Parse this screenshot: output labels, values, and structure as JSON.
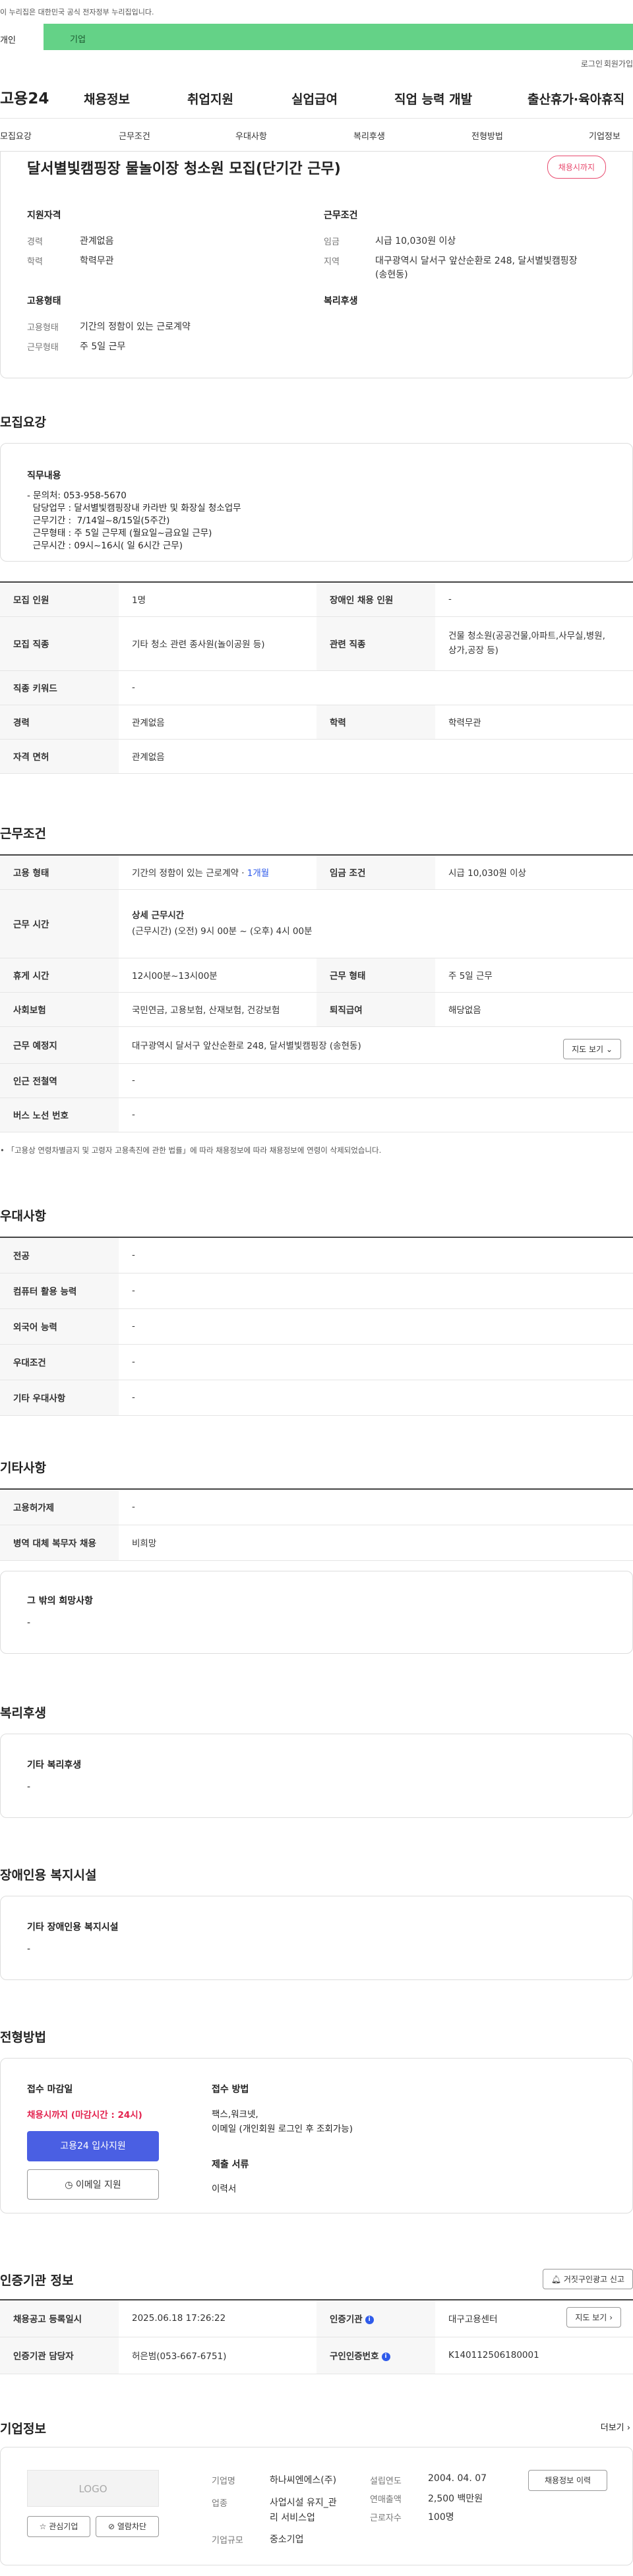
{
  "header": {
    "gov_notice": "이 누리집은 대한민국 공식 전자정부 누리집입니다.",
    "tab_individual": "개인",
    "tab_corporate": "기업",
    "login": "로그인",
    "join": "회원가입"
  },
  "gnb": {
    "logo": "고용24",
    "menus": [
      "채용정보",
      "취업지원",
      "실업급여",
      "직업 능력 개발",
      "출산휴가·육아휴직"
    ]
  },
  "subnav": [
    "모집요강",
    "근무조건",
    "우대사항",
    "복리후생",
    "전형방법",
    "기업정보"
  ],
  "summary": {
    "title": "달서별빛캠핑장 물놀이장 청소원 모집(단기간 근무)",
    "status": "채용시까지",
    "qualification_heading": "지원자격",
    "career_label": "경력",
    "career_value": "관계없음",
    "education_label": "학력",
    "education_value": "학력무관",
    "work_heading": "근무조건",
    "wage_label": "임금",
    "wage_value": "시급 10,030원 이상",
    "location_label": "지역",
    "location_value_1": "대구광역시 달서구 앞산순환로 248, 달서별빛캠핑장",
    "location_value_2": "(송현동)",
    "employment_heading": "고용형태",
    "emp_type_label": "고용형태",
    "emp_type_value": "기간의 정함이 있는 근로계약",
    "work_form_label": "근무형태",
    "work_form_value": "주 5일 근무",
    "welfare_heading": "복리후생"
  },
  "recruit": {
    "heading": "모집요강",
    "duty_heading": "직무내용",
    "duty_lines": [
      "- 문의처: 053-958-5670",
      "  담당업무 : 달서별빛캠핑장내 카라반 및 화장실 청소업무",
      "  근무기간 :  7/14일~8/15일(5주간)",
      "  근무형태 : 주 5일 근무제 (월요일~금요일 근무)",
      "  근무시간 : 09시~16시( 일 6시간 근무)"
    ],
    "rows": [
      {
        "k1": "모집 인원",
        "v1": "1명",
        "k2": "장애인 채용 인원",
        "v2": "-"
      },
      {
        "k1": "모집 직종",
        "v1": "기타 청소 관련 종사원(놀이공원 등)",
        "k2": "관련 직종",
        "v2a": "건물 청소원(공공건물,아파트,사무실,병원,",
        "v2b": "상가,공장 등)"
      },
      {
        "k1": "직종 키워드",
        "v1": "-"
      },
      {
        "k1": "경력",
        "v1": "관계없음",
        "k2": "학력",
        "v2": "학력무관"
      },
      {
        "k1": "자격 면허",
        "v1": "관계없음"
      }
    ]
  },
  "conditions": {
    "heading": "근무조건",
    "emp_type_k": "고용 형태",
    "emp_type_v": "기간의 정함이 있는 근로계약 · ",
    "emp_type_v_blue": "1개월",
    "wage_k": "임금 조건",
    "wage_v": "시급 10,030원 이상",
    "hours_k": "근무 시간",
    "hours_title": "상세 근무시간",
    "hours_v": "(근무시간) (오전) 9시 00분 ~ (오후) 4시 00분",
    "break_k": "휴게 시간",
    "break_v": "12시00분~13시00분",
    "form_k": "근무 형태",
    "form_v": "주 5일 근무",
    "insurance_k": "사회보험",
    "insurance_v": "국민연금, 고용보험, 산재보험, 건강보험",
    "severance_k": "퇴직급여",
    "severance_v": "해당없음",
    "place_k": "근무 예정지",
    "place_v": "대구광역시 달서구 앞산순환로 248, 달서별빛캠핑장 (송현동)",
    "map_button": "지도 보기",
    "subway_k": "인근 전철역",
    "subway_v": "-",
    "bus_k": "버스 노선 번호",
    "bus_v": "-",
    "note": "「고용상 연령차별금지 및 고령자 고용촉진에 관한 법률」에 따라 채용정보에 따라 채용정보에 연령이 삭제되었습니다."
  },
  "preferences": {
    "heading": "우대사항",
    "rows": [
      {
        "k": "전공",
        "v": "-"
      },
      {
        "k": "컴퓨터 활용 능력",
        "v": "-"
      },
      {
        "k": "외국어 능력",
        "v": "-"
      },
      {
        "k": "우대조건",
        "v": "-"
      },
      {
        "k": "기타 우대사항",
        "v": "-"
      }
    ]
  },
  "etc": {
    "heading": "기타사항",
    "rows": [
      {
        "k": "고용허가제",
        "v": "-"
      },
      {
        "k": "병역 대체 복무자 채용",
        "v": "비희망"
      }
    ],
    "other_heading": "그 밖의 희망사항",
    "other_value": "-"
  },
  "welfare": {
    "heading": "복리후생",
    "sub_heading": "기타 복리후생",
    "value": "-"
  },
  "disability": {
    "heading": "장애인용 복지시설",
    "sub_heading": "기타 장애인용 복지시설",
    "value": "-"
  },
  "selection": {
    "heading": "전형방법",
    "deadline_heading": "접수 마감일",
    "deadline_value": "채용시까지 (마감시간 : 24시)",
    "apply_button": "고용24 입사지원",
    "email_button": "이메일 지원",
    "method_heading": "접수 방법",
    "method_line1": "팩스,워크넷,",
    "method_line2": "이메일 (개인회원 로그인 후 조회가능)",
    "docs_heading": "제출 서류",
    "docs_value": "이력서"
  },
  "certification": {
    "heading": "인증기관 정보",
    "report_button": "거짓구인광고 신고",
    "reg_date_k": "채용공고 등록일시",
    "reg_date_v": "2025.06.18 17:26:22",
    "agency_k": "인증기관",
    "agency_v": "대구고용센터",
    "map_button": "지도 보기",
    "manager_k": "인증기관 담당자",
    "manager_v": "허은범(053-667-6751)",
    "cert_no_k": "구인인증번호",
    "cert_no_v": "K140112506180001"
  },
  "company": {
    "heading": "기업정보",
    "more": "더보기",
    "logo": "LOGO",
    "fav_button": "관심기업",
    "block_button": "열람차단",
    "name_k": "기업명",
    "name_v": "하나씨엔에스(주)",
    "industry_k": "업종",
    "industry_v1": "사업시설 유지_관",
    "industry_v2": "리 서비스업",
    "size_k": "기업규모",
    "size_v": "중소기업",
    "founded_k": "설립연도",
    "founded_v": "2004. 04. 07",
    "sales_k": "연매출액",
    "sales_v": "2,500 백만원",
    "employees_k": "근로자수",
    "employees_v": "100명",
    "history_button": "채용정보 이력"
  }
}
